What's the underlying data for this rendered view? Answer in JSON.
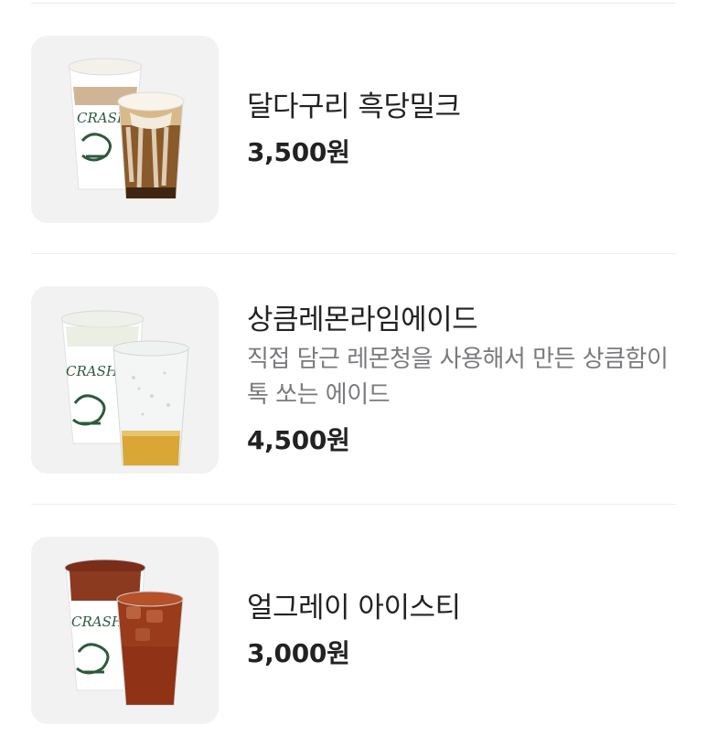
{
  "menu": {
    "items": [
      {
        "name": "달다구리 흑당밀크",
        "description": "",
        "price": "3,500원",
        "image_icon": "black-sugar-milk-drink-image"
      },
      {
        "name": "상큼레몬라임에이드",
        "description": "직접 담근 레몬청을 사용해서 만든 상큼함이 톡 쏘는 에이드",
        "price": "4,500원",
        "image_icon": "lemon-lime-ade-drink-image"
      },
      {
        "name": "얼그레이 아이스티",
        "description": "",
        "price": "3,000원",
        "image_icon": "earl-grey-iced-tea-drink-image"
      }
    ],
    "cup_brand": "CRASH"
  },
  "colors": {
    "divider": "#ececee",
    "thumb_bg": "#f2f2f3",
    "name_text": "#222222",
    "desc_text": "#7a7a7e",
    "cup_logo_green": "#2e5a3c"
  }
}
